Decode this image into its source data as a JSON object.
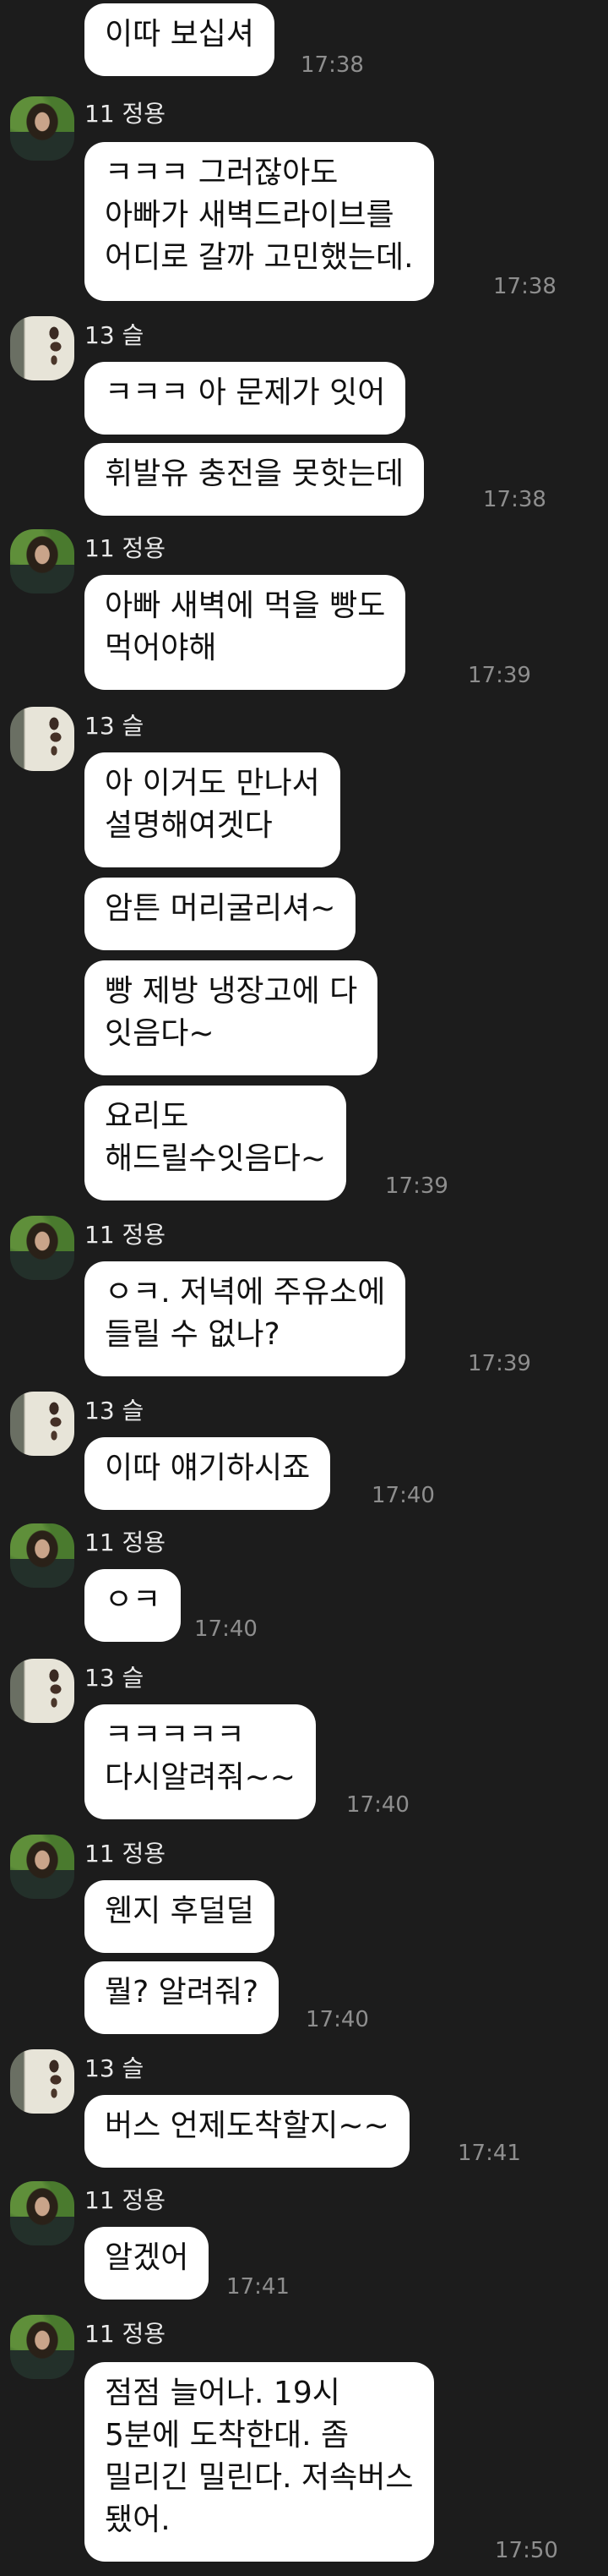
{
  "messages": [
    {
      "text": "이따 보십셔",
      "time": "17:38"
    },
    {
      "sender": "11 정용",
      "text": "ㅋㅋㅋ 그러잖아도\n아빠가 새벽드라이브를\n어디로 갈까 고민했는데.",
      "time": "17:38"
    },
    {
      "sender": "13 슬",
      "text": "ㅋㅋㅋ 아 문제가 잇어"
    },
    {
      "text": "휘발유 충전을 못핫는데",
      "time": "17:38"
    },
    {
      "sender": "11 정용",
      "text": "아빠 새벽에 먹을 빵도\n먹어야해",
      "time": "17:39"
    },
    {
      "sender": "13 슬",
      "text": "아 이거도 만나서\n설명해여겟다"
    },
    {
      "text": "암튼 머리굴리셔~"
    },
    {
      "text": "빵 제방 냉장고에 다\n잇음다~"
    },
    {
      "text": "요리도\n해드릴수잇음다~",
      "time": "17:39"
    },
    {
      "sender": "11 정용",
      "text": "ㅇㅋ. 저녁에 주유소에\n들릴 수 없나?",
      "time": "17:39"
    },
    {
      "sender": "13 슬",
      "text": "이따 얘기하시죠",
      "time": "17:40"
    },
    {
      "sender": "11 정용",
      "text": "ㅇㅋ",
      "time": "17:40"
    },
    {
      "sender": "13 슬",
      "text": "ㅋㅋㅋㅋㅋ\n다시알려줘~~",
      "time": "17:40"
    },
    {
      "sender": "11 정용",
      "text": "웬지 후덜덜"
    },
    {
      "text": "뭘? 알려줘?",
      "time": "17:40"
    },
    {
      "sender": "13 슬",
      "text": "버스 언제도착할지~~",
      "time": "17:41"
    },
    {
      "sender": "11 정용",
      "text": "알겠어",
      "time": "17:41"
    },
    {
      "sender": "11 정용",
      "text": "점점 늘어나. 19시\n5분에 도착한대.  좀\n밀리긴 밀린다. 저속버스\n됐어.",
      "time": "17:50"
    }
  ]
}
